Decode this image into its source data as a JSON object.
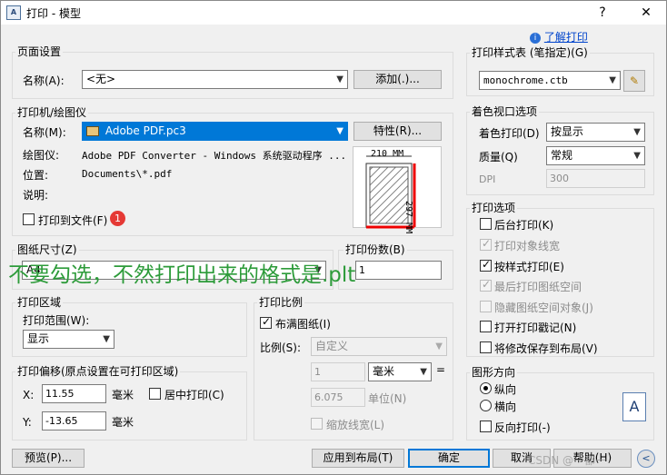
{
  "window": {
    "title": "打印 - 模型",
    "help_symbol": "?",
    "close_symbol": "✕",
    "app_icon": "A"
  },
  "help_link": "了解打印",
  "page_setup": {
    "title": "页面设置",
    "name_label": "名称(A):",
    "name_value": "<无>",
    "add_button": "添加(.)..."
  },
  "printer": {
    "title": "打印机/绘图仪",
    "name_label": "名称(M):",
    "name_value": "Adobe PDF.pc3",
    "properties_button": "特性(R)...",
    "plotter_label": "绘图仪:",
    "plotter_value": "Adobe PDF Converter - Windows 系统驱动程序 ...",
    "location_label": "位置:",
    "location_value": "Documents\\*.pdf",
    "description_label": "说明:",
    "print_to_file_label": "打印到文件(F)",
    "print_to_file_checked": false,
    "badge": "1",
    "preview_width": "210 MM",
    "preview_height": "297 MM"
  },
  "annotation": "不要勾选，不然打印出来的格式是.plt",
  "paper_size": {
    "title": "图纸尺寸(Z)",
    "value": "A4"
  },
  "copies": {
    "title": "打印份数(B)",
    "value": "1"
  },
  "plot_area": {
    "title": "打印区域",
    "range_label": "打印范围(W):",
    "range_value": "显示"
  },
  "plot_offset": {
    "title": "打印偏移(原点设置在可打印区域)",
    "x_label": "X:",
    "x_value": "11.55",
    "y_label": "Y:",
    "y_value": "-13.65",
    "unit": "毫米",
    "center_label": "居中打印(C)",
    "center_checked": false
  },
  "plot_scale": {
    "title": "打印比例",
    "fit_label": "布满图纸(I)",
    "fit_checked": true,
    "scale_label": "比例(S):",
    "scale_value": "自定义",
    "value1": "1",
    "unit1": "毫米",
    "equals": "=",
    "value2": "6.075",
    "unit2": "单位(N)",
    "lineweights_label": "缩放线宽(L)"
  },
  "plot_style_table": {
    "title": "打印样式表 (笔指定)(G)",
    "value": "monochrome.ctb"
  },
  "shaded_viewport": {
    "title": "着色视口选项",
    "shade_label": "着色打印(D)",
    "shade_value": "按显示",
    "quality_label": "质量(Q)",
    "quality_value": "常规",
    "dpi_label": "DPI",
    "dpi_value": "300"
  },
  "plot_options": {
    "title": "打印选项",
    "items": [
      {
        "label": "后台打印(K)",
        "checked": false,
        "disabled": false
      },
      {
        "label": "打印对象线宽",
        "checked": true,
        "disabled": true
      },
      {
        "label": "按样式打印(E)",
        "checked": true,
        "disabled": false
      },
      {
        "label": "最后打印图纸空间",
        "checked": true,
        "disabled": true
      },
      {
        "label": "隐藏图纸空间对象(J)",
        "checked": false,
        "disabled": true
      },
      {
        "label": "打开打印戳记(N)",
        "checked": false,
        "disabled": false
      },
      {
        "label": "将修改保存到布局(V)",
        "checked": false,
        "disabled": false
      }
    ]
  },
  "orientation": {
    "title": "图形方向",
    "portrait_label": "纵向",
    "landscape_label": "横向",
    "upside_down_label": "反向打印(-)",
    "selected": "portrait",
    "icon_letter": "A"
  },
  "footer": {
    "preview_button": "预览(P)...",
    "apply_button": "应用到布局(T)",
    "ok_button": "确定",
    "cancel_button": "取消",
    "help_button": "帮助(H)",
    "watermark": "CSDN @一都一",
    "expand_symbol": "<"
  }
}
